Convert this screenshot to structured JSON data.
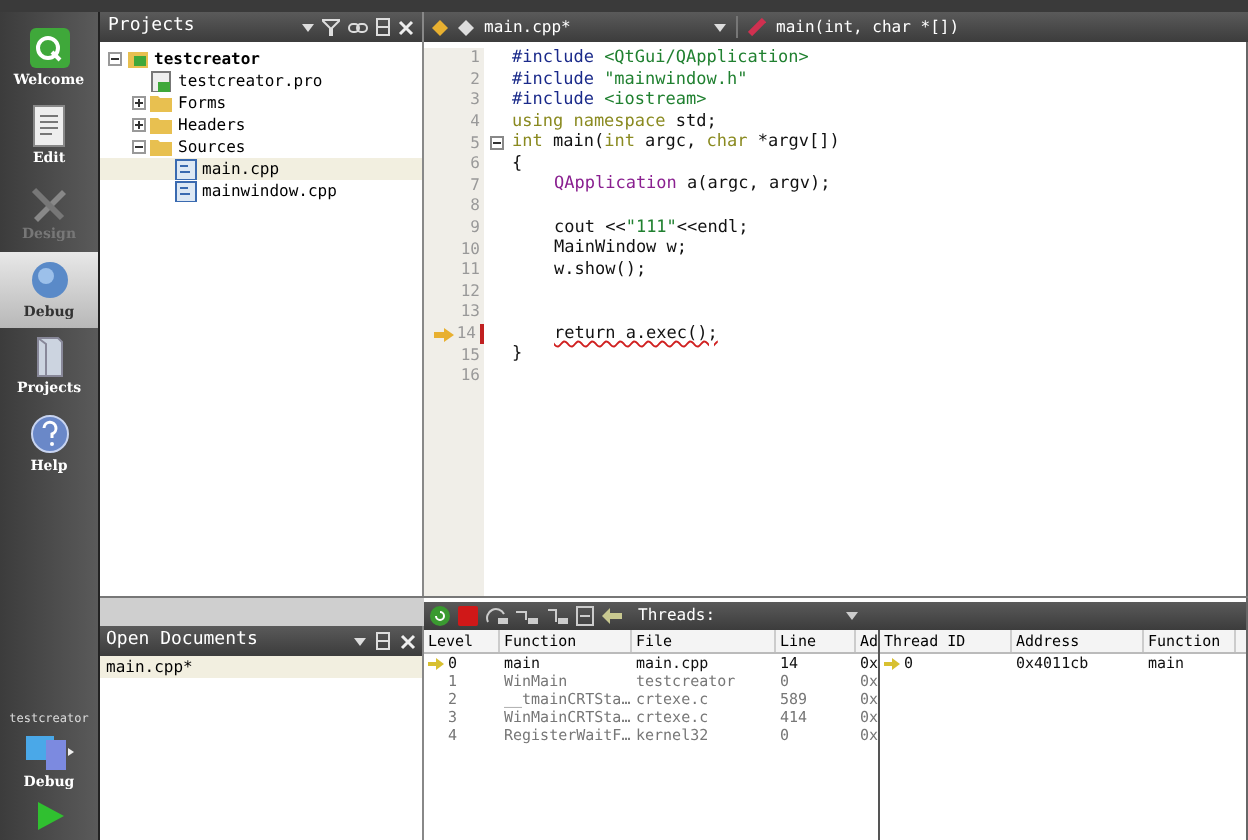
{
  "mode_bar": {
    "items": [
      {
        "label": "Welcome",
        "kind": "qt",
        "selected": false,
        "disabled": false
      },
      {
        "label": "Edit",
        "kind": "edit",
        "selected": false,
        "disabled": false
      },
      {
        "label": "Design",
        "kind": "design",
        "selected": false,
        "disabled": true
      },
      {
        "label": "Debug",
        "kind": "debug",
        "selected": true,
        "disabled": false
      },
      {
        "label": "Projects",
        "kind": "projects",
        "selected": false,
        "disabled": false
      },
      {
        "label": "Help",
        "kind": "help",
        "selected": false,
        "disabled": false
      }
    ],
    "target": {
      "project": "testcreator",
      "label": "Debug"
    }
  },
  "projects_panel": {
    "title": "Projects",
    "tree": [
      {
        "label": "testcreator",
        "kind": "project",
        "expanded": true,
        "selected": false,
        "children": [
          {
            "label": "testcreator.pro",
            "kind": "profile",
            "selected": false
          },
          {
            "label": "Forms",
            "kind": "folder",
            "expanded": false,
            "selected": false
          },
          {
            "label": "Headers",
            "kind": "folder",
            "expanded": false,
            "selected": false
          },
          {
            "label": "Sources",
            "kind": "folder",
            "expanded": true,
            "selected": false,
            "children": [
              {
                "label": "main.cpp",
                "kind": "cpp",
                "selected": true
              },
              {
                "label": "mainwindow.cpp",
                "kind": "cpp",
                "selected": false
              }
            ]
          }
        ]
      }
    ]
  },
  "open_documents": {
    "title": "Open Documents",
    "items": [
      {
        "label": "main.cpp*",
        "selected": true
      }
    ]
  },
  "editor": {
    "file": "main.cpp*",
    "symbol": "main(int, char *[])",
    "lines": [
      {
        "number": "1",
        "current": false,
        "fold": false,
        "segments": [
          {
            "text": "#include ",
            "kind": "pre"
          },
          {
            "text": "<QtGui/QApplication>",
            "kind": "str"
          }
        ]
      },
      {
        "number": "2",
        "current": false,
        "fold": false,
        "segments": [
          {
            "text": "#include ",
            "kind": "pre"
          },
          {
            "text": "\"mainwindow.h\"",
            "kind": "str"
          }
        ]
      },
      {
        "number": "3",
        "current": false,
        "fold": false,
        "segments": [
          {
            "text": "#include ",
            "kind": "pre"
          },
          {
            "text": "<iostream>",
            "kind": "str"
          }
        ]
      },
      {
        "number": "4",
        "current": false,
        "fold": false,
        "segments": [
          {
            "text": "using namespace",
            "kind": "kw"
          },
          {
            "text": " std;",
            "kind": "plain"
          }
        ]
      },
      {
        "number": "5",
        "current": false,
        "fold": true,
        "segments": [
          {
            "text": "int",
            "kind": "kw"
          },
          {
            "text": " main(",
            "kind": "plain"
          },
          {
            "text": "int",
            "kind": "kw"
          },
          {
            "text": " argc, ",
            "kind": "plain"
          },
          {
            "text": "char",
            "kind": "kw"
          },
          {
            "text": " *argv[])",
            "kind": "plain"
          }
        ]
      },
      {
        "number": "6",
        "current": false,
        "fold": false,
        "segments": [
          {
            "text": "{",
            "kind": "plain"
          }
        ]
      },
      {
        "number": "7",
        "current": false,
        "fold": false,
        "indent": true,
        "segments": [
          {
            "text": "QApplication",
            "kind": "type"
          },
          {
            "text": " a(argc, argv);",
            "kind": "plain"
          }
        ]
      },
      {
        "number": "8",
        "current": false,
        "fold": false
      },
      {
        "number": "9",
        "current": false,
        "fold": false,
        "indent": true,
        "segments": [
          {
            "text": "cout <<",
            "kind": "plain"
          },
          {
            "text": "\"111\"",
            "kind": "str"
          },
          {
            "text": "<<endl;",
            "kind": "plain"
          }
        ]
      },
      {
        "number": "10",
        "current": false,
        "fold": false,
        "indent": true,
        "segments": [
          {
            "text": "MainWindow w;",
            "kind": "plain"
          }
        ]
      },
      {
        "number": "11",
        "current": false,
        "fold": false,
        "indent": true,
        "segments": [
          {
            "text": "w.show();",
            "kind": "plain"
          }
        ]
      },
      {
        "number": "12",
        "current": false,
        "fold": false
      },
      {
        "number": "13",
        "current": false,
        "fold": false
      },
      {
        "number": "14",
        "current": true,
        "fold": false,
        "indent": true,
        "segments": [
          {
            "text": "return a.exec();",
            "kind": "err"
          }
        ]
      },
      {
        "number": "15",
        "current": false,
        "fold": false,
        "segments": [
          {
            "text": "}",
            "kind": "plain"
          }
        ]
      },
      {
        "number": "16",
        "current": false,
        "fold": false
      }
    ]
  },
  "debugger": {
    "threads_label": "Threads:",
    "stack": {
      "columns": [
        "Level",
        "Function",
        "File",
        "Line",
        "Ad"
      ],
      "rows": [
        {
          "current": true,
          "cells": [
            "0",
            "main",
            "main.cpp",
            "14",
            "0x"
          ]
        },
        {
          "current": false,
          "cells": [
            "1",
            "WinMain",
            "testcreator",
            "0",
            "0x"
          ]
        },
        {
          "current": false,
          "cells": [
            "2",
            "__tmainCRTSta…",
            "crtexe.c",
            "589",
            "0x"
          ]
        },
        {
          "current": false,
          "cells": [
            "3",
            "WinMainCRTSta…",
            "crtexe.c",
            "414",
            "0x"
          ]
        },
        {
          "current": false,
          "cells": [
            "4",
            "RegisterWaitF…",
            "kernel32",
            "0",
            "0x"
          ]
        }
      ]
    },
    "threads": {
      "columns": [
        "Thread ID",
        "Address",
        "Function"
      ],
      "rows": [
        {
          "current": true,
          "cells": [
            "0",
            "0x4011cb",
            "main"
          ]
        }
      ]
    }
  }
}
